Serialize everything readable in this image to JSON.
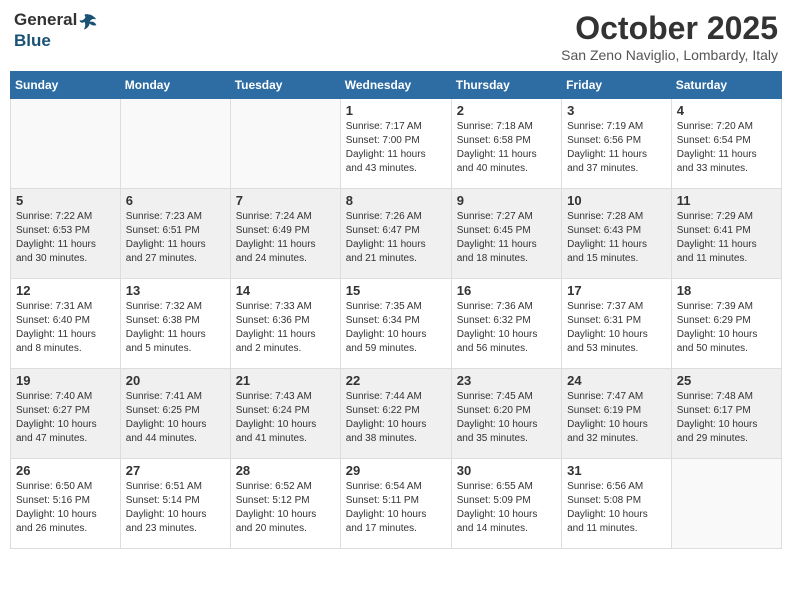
{
  "header": {
    "logo_general": "General",
    "logo_blue": "Blue",
    "month_title": "October 2025",
    "location": "San Zeno Naviglio, Lombardy, Italy"
  },
  "weekdays": [
    "Sunday",
    "Monday",
    "Tuesday",
    "Wednesday",
    "Thursday",
    "Friday",
    "Saturday"
  ],
  "weeks": [
    [
      {
        "day": "",
        "info": ""
      },
      {
        "day": "",
        "info": ""
      },
      {
        "day": "",
        "info": ""
      },
      {
        "day": "1",
        "info": "Sunrise: 7:17 AM\nSunset: 7:00 PM\nDaylight: 11 hours\nand 43 minutes."
      },
      {
        "day": "2",
        "info": "Sunrise: 7:18 AM\nSunset: 6:58 PM\nDaylight: 11 hours\nand 40 minutes."
      },
      {
        "day": "3",
        "info": "Sunrise: 7:19 AM\nSunset: 6:56 PM\nDaylight: 11 hours\nand 37 minutes."
      },
      {
        "day": "4",
        "info": "Sunrise: 7:20 AM\nSunset: 6:54 PM\nDaylight: 11 hours\nand 33 minutes."
      }
    ],
    [
      {
        "day": "5",
        "info": "Sunrise: 7:22 AM\nSunset: 6:53 PM\nDaylight: 11 hours\nand 30 minutes."
      },
      {
        "day": "6",
        "info": "Sunrise: 7:23 AM\nSunset: 6:51 PM\nDaylight: 11 hours\nand 27 minutes."
      },
      {
        "day": "7",
        "info": "Sunrise: 7:24 AM\nSunset: 6:49 PM\nDaylight: 11 hours\nand 24 minutes."
      },
      {
        "day": "8",
        "info": "Sunrise: 7:26 AM\nSunset: 6:47 PM\nDaylight: 11 hours\nand 21 minutes."
      },
      {
        "day": "9",
        "info": "Sunrise: 7:27 AM\nSunset: 6:45 PM\nDaylight: 11 hours\nand 18 minutes."
      },
      {
        "day": "10",
        "info": "Sunrise: 7:28 AM\nSunset: 6:43 PM\nDaylight: 11 hours\nand 15 minutes."
      },
      {
        "day": "11",
        "info": "Sunrise: 7:29 AM\nSunset: 6:41 PM\nDaylight: 11 hours\nand 11 minutes."
      }
    ],
    [
      {
        "day": "12",
        "info": "Sunrise: 7:31 AM\nSunset: 6:40 PM\nDaylight: 11 hours\nand 8 minutes."
      },
      {
        "day": "13",
        "info": "Sunrise: 7:32 AM\nSunset: 6:38 PM\nDaylight: 11 hours\nand 5 minutes."
      },
      {
        "day": "14",
        "info": "Sunrise: 7:33 AM\nSunset: 6:36 PM\nDaylight: 11 hours\nand 2 minutes."
      },
      {
        "day": "15",
        "info": "Sunrise: 7:35 AM\nSunset: 6:34 PM\nDaylight: 10 hours\nand 59 minutes."
      },
      {
        "day": "16",
        "info": "Sunrise: 7:36 AM\nSunset: 6:32 PM\nDaylight: 10 hours\nand 56 minutes."
      },
      {
        "day": "17",
        "info": "Sunrise: 7:37 AM\nSunset: 6:31 PM\nDaylight: 10 hours\nand 53 minutes."
      },
      {
        "day": "18",
        "info": "Sunrise: 7:39 AM\nSunset: 6:29 PM\nDaylight: 10 hours\nand 50 minutes."
      }
    ],
    [
      {
        "day": "19",
        "info": "Sunrise: 7:40 AM\nSunset: 6:27 PM\nDaylight: 10 hours\nand 47 minutes."
      },
      {
        "day": "20",
        "info": "Sunrise: 7:41 AM\nSunset: 6:25 PM\nDaylight: 10 hours\nand 44 minutes."
      },
      {
        "day": "21",
        "info": "Sunrise: 7:43 AM\nSunset: 6:24 PM\nDaylight: 10 hours\nand 41 minutes."
      },
      {
        "day": "22",
        "info": "Sunrise: 7:44 AM\nSunset: 6:22 PM\nDaylight: 10 hours\nand 38 minutes."
      },
      {
        "day": "23",
        "info": "Sunrise: 7:45 AM\nSunset: 6:20 PM\nDaylight: 10 hours\nand 35 minutes."
      },
      {
        "day": "24",
        "info": "Sunrise: 7:47 AM\nSunset: 6:19 PM\nDaylight: 10 hours\nand 32 minutes."
      },
      {
        "day": "25",
        "info": "Sunrise: 7:48 AM\nSunset: 6:17 PM\nDaylight: 10 hours\nand 29 minutes."
      }
    ],
    [
      {
        "day": "26",
        "info": "Sunrise: 6:50 AM\nSunset: 5:16 PM\nDaylight: 10 hours\nand 26 minutes."
      },
      {
        "day": "27",
        "info": "Sunrise: 6:51 AM\nSunset: 5:14 PM\nDaylight: 10 hours\nand 23 minutes."
      },
      {
        "day": "28",
        "info": "Sunrise: 6:52 AM\nSunset: 5:12 PM\nDaylight: 10 hours\nand 20 minutes."
      },
      {
        "day": "29",
        "info": "Sunrise: 6:54 AM\nSunset: 5:11 PM\nDaylight: 10 hours\nand 17 minutes."
      },
      {
        "day": "30",
        "info": "Sunrise: 6:55 AM\nSunset: 5:09 PM\nDaylight: 10 hours\nand 14 minutes."
      },
      {
        "day": "31",
        "info": "Sunrise: 6:56 AM\nSunset: 5:08 PM\nDaylight: 10 hours\nand 11 minutes."
      },
      {
        "day": "",
        "info": ""
      }
    ]
  ]
}
